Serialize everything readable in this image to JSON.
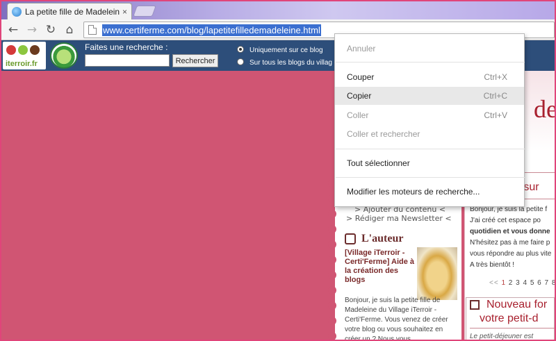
{
  "browser": {
    "tab": {
      "title": "La petite fille de Madeleine",
      "close_glyph": "×"
    },
    "nav": {
      "back_glyph": "←",
      "forward_glyph": "→",
      "reload_glyph": "↻",
      "home_glyph": "⌂"
    },
    "url": "www.certiferme.com/blog/lapetitefilledemadeleine.html"
  },
  "page": {
    "logo_text": "iterroir.fr",
    "search": {
      "label": "Faites une recherche :",
      "input_value": "",
      "button_label": "Rechercher",
      "option_1": "Uniquement sur ce blog",
      "option_2": "Sur tous les blogs du villag"
    },
    "heading_partial": "de",
    "heading_sur": "e sur",
    "mid_links": [
      "> Ajouter du contenu <",
      "> Rédiger ma Newsletter <"
    ],
    "auteur": {
      "title": "L'auteur",
      "desc": "[Village iTerroir - Certi'Ferme] Aide à la création des blogs",
      "bio": "Bonjour, je suis la petite fille de Madeleine du Village iTerroir - Certi'Ferme. Vous venez de créer votre blog ou vous souhaitez en créer un ? Nous vous"
    },
    "right_text": {
      "line1": "Bonjour, je suis la petite f",
      "line2": "J'ai créé cet espace po",
      "line3": "quotidien et vous donne",
      "line4": "N'hésitez pas à me faire p",
      "line5": "vous répondre au plus vite",
      "line6": "A très bientôt !"
    },
    "pager": {
      "prev": "<< ",
      "current": "1",
      "pages": " 2 3 4 5 6 7 8"
    },
    "forum": {
      "title_1": "Nouveau for",
      "title_2": "votre petit-d",
      "sub": "Le petit-déjeuner est"
    }
  },
  "context_menu": {
    "items": [
      {
        "label": "Annuler",
        "shortcut": ""
      },
      {
        "label": "Couper",
        "shortcut": "Ctrl+X"
      },
      {
        "label": "Copier",
        "shortcut": "Ctrl+C"
      },
      {
        "label": "Coller",
        "shortcut": "Ctrl+V"
      },
      {
        "label": "Coller et rechercher",
        "shortcut": ""
      },
      {
        "label": "Tout sélectionner",
        "shortcut": ""
      },
      {
        "label": "Modifier les moteurs de recherche...",
        "shortcut": ""
      }
    ]
  },
  "colors": {
    "accent_pink": "#d05573",
    "header_blue": "#2d4e7a",
    "title_red": "#a8202e"
  }
}
